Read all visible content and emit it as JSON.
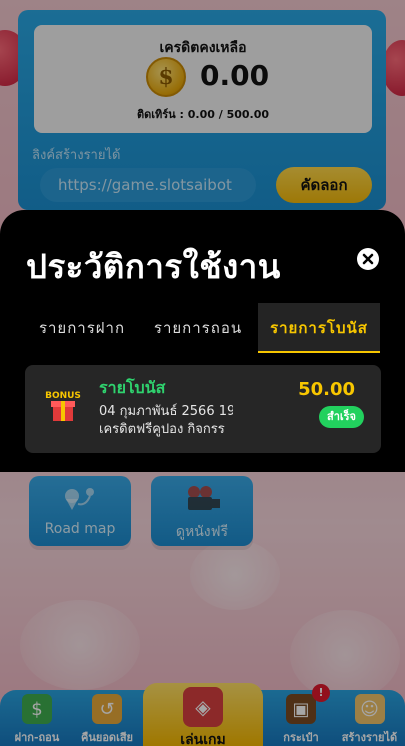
{
  "credit": {
    "title": "เครดิตคงเหลือ",
    "coin_symbol": "$",
    "amount": "0.00",
    "turnover": "ติดเทิร์น : 0.00 / 500.00"
  },
  "referral": {
    "label": "ลิงค์สร้างรายได้",
    "url": "https://game.slotsaibot",
    "copy_label": "คัดลอก"
  },
  "tiles": [
    {
      "label": "Road map",
      "icon": "map-pin-icon"
    },
    {
      "label": "ดูหนังฟรี",
      "icon": "movie-camera-icon"
    }
  ],
  "modal": {
    "title": "ประวัติการใช้งาน",
    "tabs": [
      {
        "label": "รายการฝาก",
        "active": false
      },
      {
        "label": "รายการถอน",
        "active": false
      },
      {
        "label": "รายการโบนัส",
        "active": true
      }
    ],
    "history": [
      {
        "title": "รายโบนัส",
        "date": "04 กุมภาพันธ์ 2566 19",
        "description": "เครดิตฟรีคูปอง กิจกรร",
        "amount": "50.00",
        "status": "สำเร็จ",
        "icon": "bonus-icon",
        "icon_text": "BONUS"
      }
    ]
  },
  "nav": {
    "items": [
      {
        "label": "ฝาก-ถอน",
        "icon": "money-icon"
      },
      {
        "label": "คืนยอดเสีย",
        "icon": "refund-icon"
      },
      {
        "label": "เล่นเกม",
        "icon": "slot-machine-icon"
      },
      {
        "label": "กระเป๋า",
        "icon": "wallet-icon"
      },
      {
        "label": "สร้างรายได้",
        "icon": "friends-icon"
      }
    ],
    "badge": "!"
  },
  "colors": {
    "accent": "#f7c600",
    "success": "#22d15e",
    "bonus_title": "#2fd26e",
    "nav": "#1b8fd0"
  }
}
